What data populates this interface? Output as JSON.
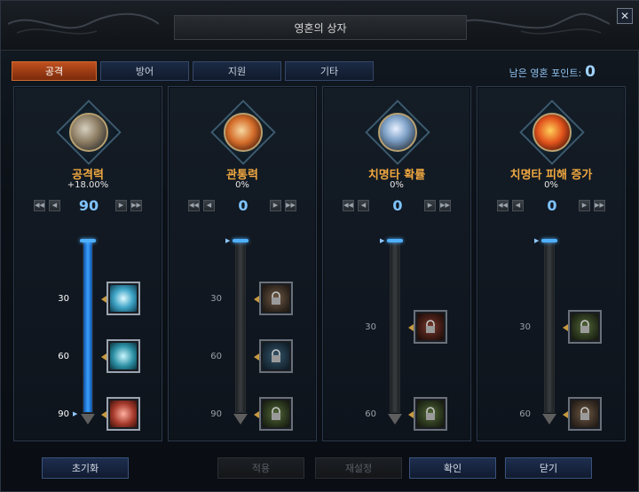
{
  "window": {
    "title": "영혼의 상자",
    "close_label": "✕"
  },
  "tabs": [
    {
      "label": "공격",
      "active": true
    },
    {
      "label": "방어",
      "active": false
    },
    {
      "label": "지원",
      "active": false
    },
    {
      "label": "기타",
      "active": false
    }
  ],
  "points": {
    "label": "남은 영혼 포인트:",
    "value": "0"
  },
  "stats": [
    {
      "name": "공격력",
      "value": "+18.00%",
      "level": "90",
      "orb_icon": "gauntlet-orb-icon",
      "track_fill_fraction": 1.0,
      "ticks": [
        {
          "label": "30",
          "active": true
        },
        {
          "label": "60",
          "active": true
        },
        {
          "label": "90",
          "active": true
        }
      ],
      "nodes": [
        {
          "icon": "ice-slash-icon",
          "locked": false
        },
        {
          "icon": "water-fist-icon",
          "locked": false
        },
        {
          "icon": "flame-claw-icon",
          "locked": false
        }
      ]
    },
    {
      "name": "관통력",
      "value": "0%",
      "level": "0",
      "orb_icon": "pierce-orb-icon",
      "track_fill_fraction": 0,
      "ticks": [
        {
          "label": "30",
          "active": false
        },
        {
          "label": "60",
          "active": false
        },
        {
          "label": "90",
          "active": false
        }
      ],
      "nodes": [
        {
          "icon": "locked-skill-icon",
          "locked": true
        },
        {
          "icon": "locked-skill-icon",
          "locked": true
        },
        {
          "icon": "locked-skill-icon",
          "locked": true
        }
      ]
    },
    {
      "name": "치명타 확률",
      "value": "0%",
      "level": "0",
      "orb_icon": "blades-orb-icon",
      "track_fill_fraction": 0,
      "ticks": [
        {
          "label": "30",
          "active": false
        },
        {
          "label": "60",
          "active": false
        }
      ],
      "nodes": [
        {
          "icon": "locked-skill-icon",
          "locked": true
        },
        {
          "icon": "locked-skill-icon",
          "locked": true
        }
      ]
    },
    {
      "name": "치명타 피해 증가",
      "value": "0%",
      "level": "0",
      "orb_icon": "fire-orb-icon",
      "track_fill_fraction": 0,
      "ticks": [
        {
          "label": "30",
          "active": false
        },
        {
          "label": "60",
          "active": false
        }
      ],
      "nodes": [
        {
          "icon": "locked-skill-icon",
          "locked": true
        },
        {
          "icon": "locked-skill-icon",
          "locked": true
        }
      ]
    }
  ],
  "footer": {
    "reset_label": "초기화",
    "apply_label": "적용",
    "reassign_label": "재설정",
    "confirm_label": "확인",
    "close_label": "닫기"
  }
}
